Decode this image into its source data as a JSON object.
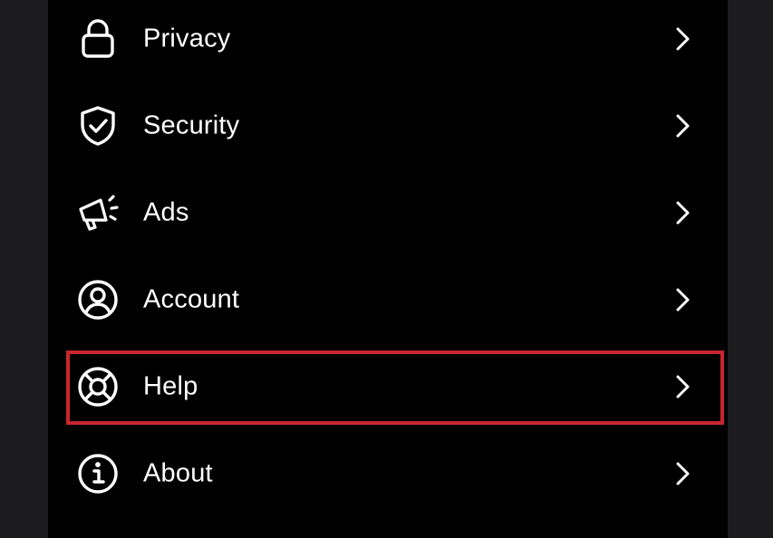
{
  "colors": {
    "background": "#000000",
    "text": "#ffffff",
    "highlight": "#c8262c"
  },
  "menu": {
    "items": [
      {
        "label": "Privacy",
        "icon": "lock-icon"
      },
      {
        "label": "Security",
        "icon": "shield-check-icon"
      },
      {
        "label": "Ads",
        "icon": "megaphone-icon"
      },
      {
        "label": "Account",
        "icon": "user-circle-icon"
      },
      {
        "label": "Help",
        "icon": "lifebuoy-icon"
      },
      {
        "label": "About",
        "icon": "info-icon"
      }
    ],
    "highlighted_item": "Help"
  }
}
